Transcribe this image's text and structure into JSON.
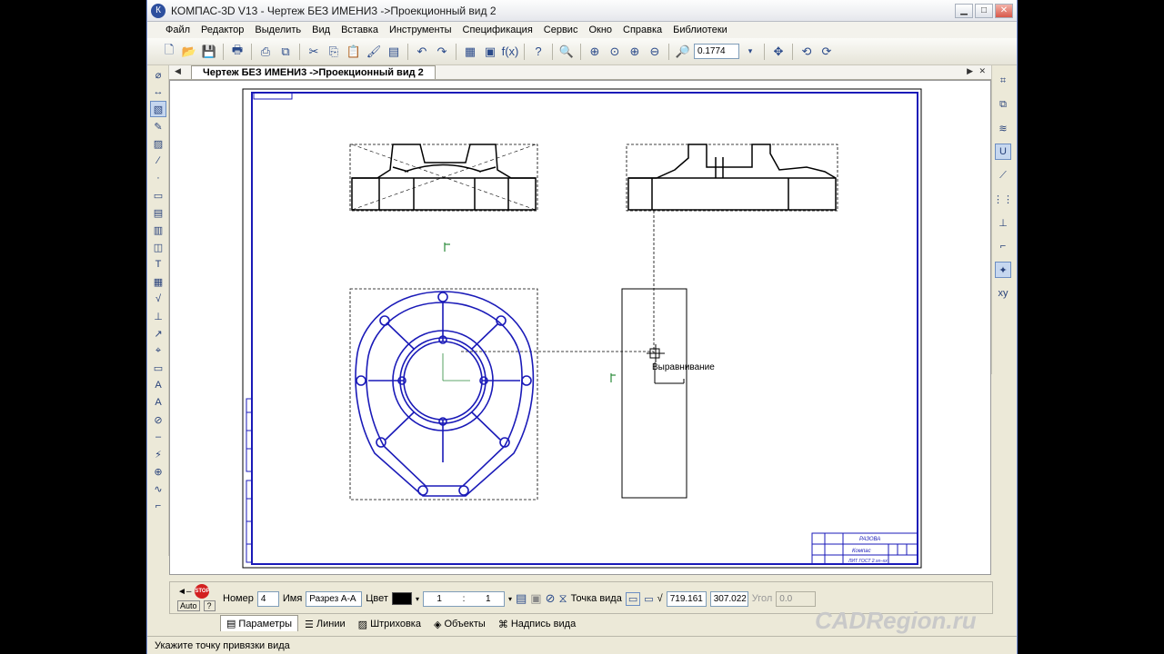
{
  "window": {
    "title": "КОМПАС-3D V13 - Чертеж БЕЗ ИМЕНИ3 ->Проекционный вид 2",
    "app_icon": "kompas-logo-icon",
    "controls": [
      "minimize-icon",
      "maximize-icon",
      "close-icon"
    ]
  },
  "menu": [
    "Файл",
    "Редактор",
    "Выделить",
    "Вид",
    "Вставка",
    "Инструменты",
    "Спецификация",
    "Сервис",
    "Окно",
    "Справка",
    "Библиотеки"
  ],
  "toolbar": {
    "zoom_value": "0.1774"
  },
  "document_tab": {
    "label": "Чертеж БЕЗ ИМЕНИ3 ->Проекционный вид 2"
  },
  "canvas": {
    "cursor_hint": "Выравнивание",
    "stamp_top_text": "РАЗОВА",
    "stamp_mid_text": "Компас",
    "stamp_bottom_text": "ЛИТ ГОСТ 2.xx–xx"
  },
  "properties": {
    "number_label": "Номер",
    "number_value": "4",
    "name_label": "Имя",
    "name_value": "Разрез А-А",
    "color_label": "Цвет",
    "scale_left": "1",
    "scale_sep": ":",
    "scale_right": "1",
    "point_label": "Точка вида",
    "x_value": "719.161",
    "y_value": "307.022",
    "angle_label": "Угол",
    "angle_value": "0.0"
  },
  "panel_tabs": [
    "Параметры",
    "Линии",
    "Штриховка",
    "Объекты",
    "Надпись вида"
  ],
  "status_text": "Укажите точку привязки вида",
  "watermark": "CADRegion.ru",
  "colors": {
    "drawing_black": "#000000",
    "drawing_blue": "#1a1ab8",
    "projection_green": "#2a8a3a",
    "accent": "#2d4f9e"
  }
}
